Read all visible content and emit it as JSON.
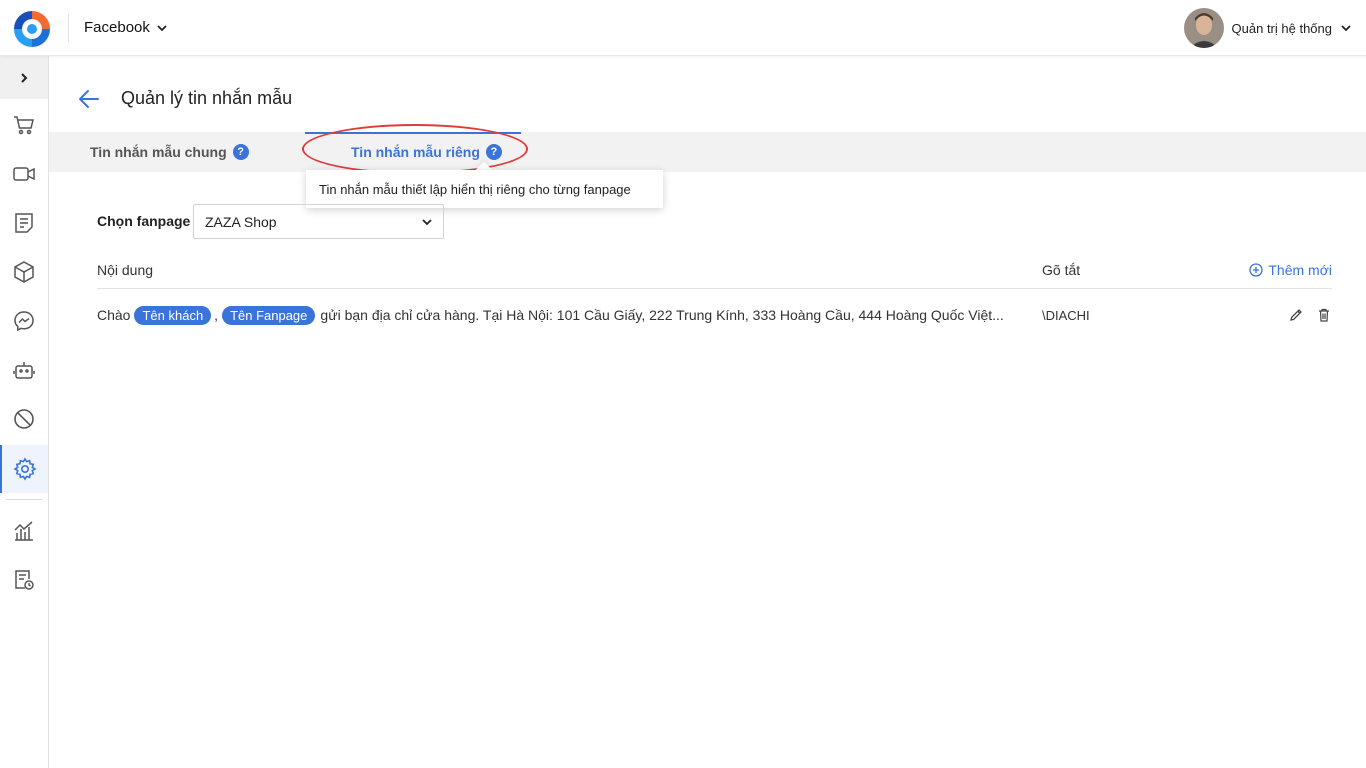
{
  "header": {
    "channel_label": "Facebook",
    "user_name": "Quản trị hệ thống"
  },
  "sidebar": {
    "items": [
      {
        "icon": "cart-icon"
      },
      {
        "icon": "video-icon"
      },
      {
        "icon": "document-icon"
      },
      {
        "icon": "box-icon"
      },
      {
        "icon": "messenger-icon"
      },
      {
        "icon": "robot-icon"
      },
      {
        "icon": "block-icon"
      },
      {
        "icon": "gear-icon",
        "active": true
      },
      {
        "icon": "chart-icon"
      },
      {
        "icon": "report-icon"
      }
    ]
  },
  "page": {
    "title": "Quản lý tin nhắn mẫu"
  },
  "tabs": {
    "general": "Tin nhắn mẫu chung",
    "private": "Tin nhắn mẫu riêng",
    "help_glyph": "?",
    "active": "private"
  },
  "tooltip": {
    "text": "Tin nhắn mẫu thiết lập hiển thị riêng cho từng fanpage"
  },
  "filter": {
    "label": "Chọn fanpage",
    "selected": "ZAZA Shop"
  },
  "table": {
    "col_content": "Nội dung",
    "col_shortcut": "Gõ tắt",
    "add_new": "Thêm mới",
    "rows": [
      {
        "prefix": "Chào",
        "chip_customer": "Tên khách",
        "separator": ",",
        "chip_fanpage": "Tên Fanpage",
        "suffix": "gửi bạn địa chỉ cửa hàng. Tại Hà Nội: 101 Cầu Giấy, 222 Trung Kính, 333 Hoàng Cầu, 444 Hoàng Quốc Việt...",
        "shortcut": "\\DIACHI"
      }
    ]
  },
  "colors": {
    "accent": "#3a73d9",
    "highlight_ring": "#e23a3a",
    "tab_bar_bg": "#f2f2f2"
  }
}
